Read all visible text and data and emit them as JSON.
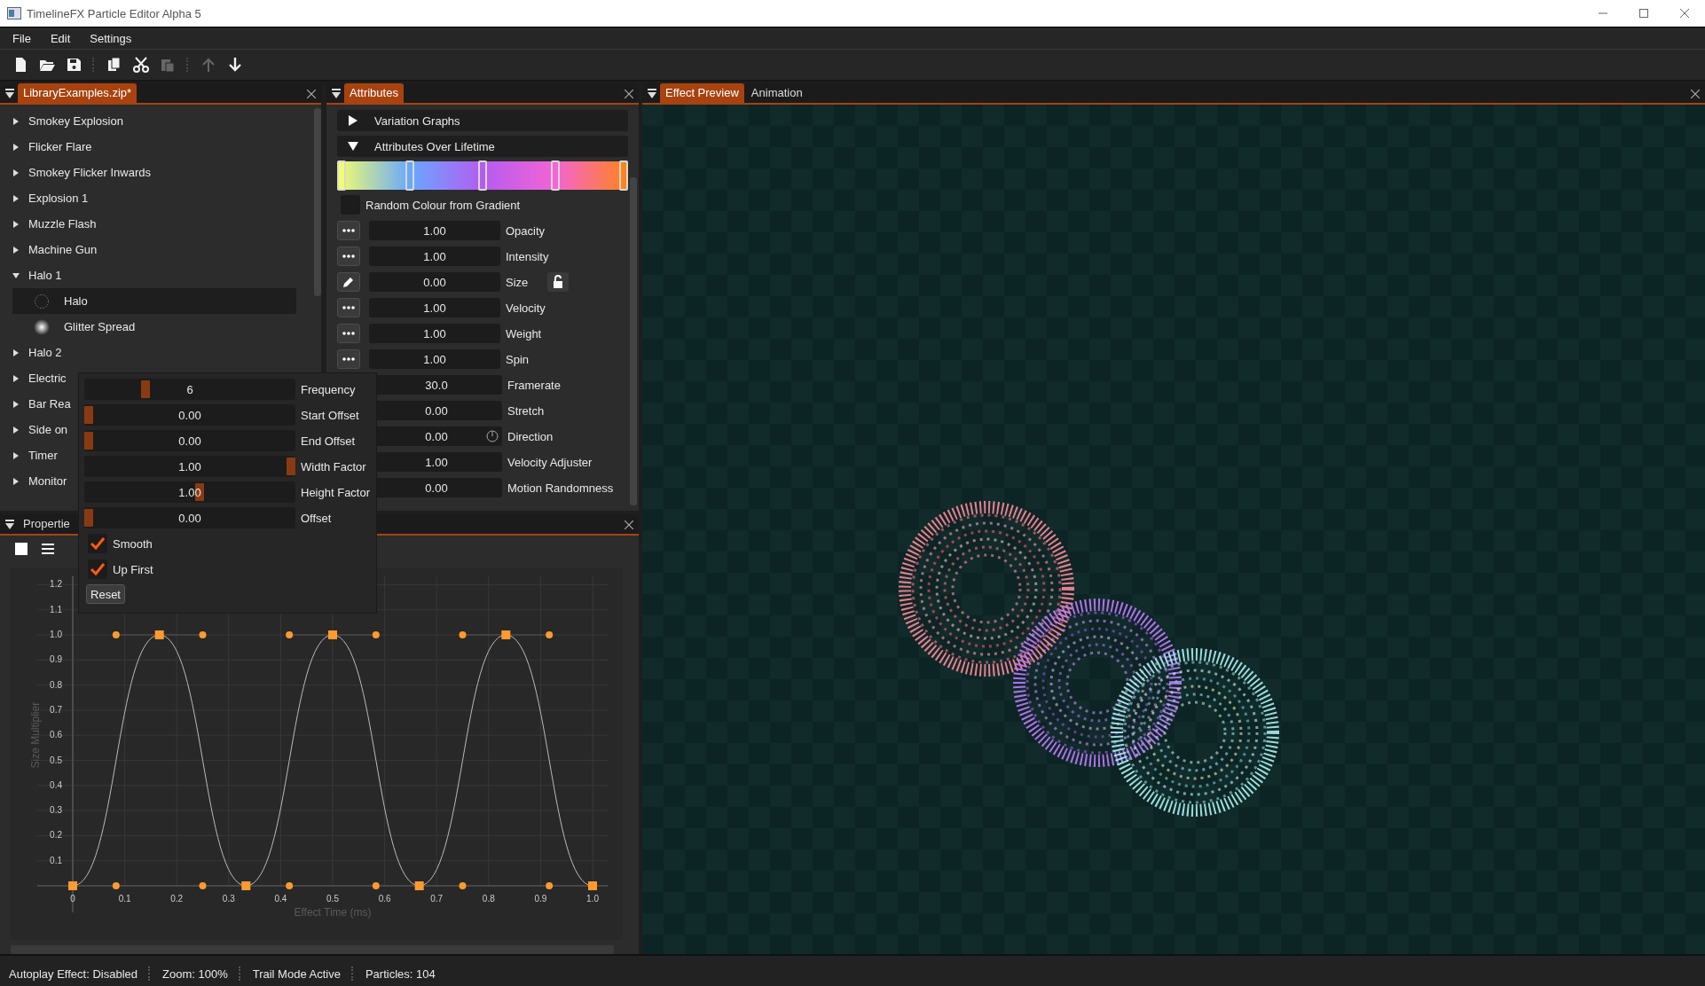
{
  "window": {
    "title": "TimelineFX Particle Editor Alpha 5"
  },
  "menu": [
    "File",
    "Edit",
    "Settings"
  ],
  "toolbar": [
    {
      "disabled": false
    },
    {
      "disabled": false
    },
    {
      "disabled": false
    },
    {
      "disabled": false
    },
    {
      "disabled": false
    },
    {
      "disabled": true
    },
    {
      "disabled": true
    },
    {
      "disabled": false
    }
  ],
  "library": {
    "tab": {
      "label": "LibraryExamples.zip*",
      "selected": true
    },
    "items": [
      {
        "label": "Smokey Explosion",
        "expanded": false,
        "selected": false
      },
      {
        "label": "Flicker Flare",
        "expanded": false,
        "selected": false
      },
      {
        "label": "Smokey Flicker Inwards",
        "expanded": false,
        "selected": false
      },
      {
        "label": "Explosion 1",
        "expanded": false,
        "selected": false
      },
      {
        "label": "Muzzle Flash",
        "expanded": false,
        "selected": false
      },
      {
        "label": "Machine Gun",
        "expanded": false,
        "selected": false
      },
      {
        "label": "Halo 1",
        "expanded": true,
        "selected": false,
        "children": [
          {
            "label": "Halo",
            "selected": true
          },
          {
            "label": "Glitter Spread",
            "selected": false
          }
        ]
      },
      {
        "label": "Halo 2",
        "expanded": false,
        "selected": false
      },
      {
        "label": "Electric",
        "expanded": false,
        "selected": false
      },
      {
        "label": "Bar Rea",
        "expanded": false,
        "selected": false
      },
      {
        "label": "Side on",
        "expanded": false,
        "selected": false
      },
      {
        "label": "Timer",
        "expanded": false,
        "selected": false
      },
      {
        "label": "Monitor",
        "expanded": false,
        "selected": false
      }
    ]
  },
  "attributes": {
    "tab": {
      "label": "Attributes",
      "selected": true
    },
    "sections": [
      {
        "label": "Variation Graphs",
        "expanded": false
      },
      {
        "label": "Attributes Over Lifetime",
        "expanded": true
      }
    ],
    "gradient": [
      {
        "color": "#f4ff6a"
      },
      {
        "color": "#68a8ff"
      },
      {
        "color": "#b45cf0"
      },
      {
        "color": "#f464d4"
      },
      {
        "color": "#ff8418"
      }
    ],
    "random_colour": {
      "label": "Random Colour from Gradient",
      "checked": false
    },
    "rows": [
      {
        "label": "Opacity",
        "value": "1.00",
        "kind": "graph"
      },
      {
        "label": "Intensity",
        "value": "1.00",
        "kind": "graph"
      },
      {
        "label": "Size",
        "value": "0.00",
        "kind": "edited",
        "locked": false
      },
      {
        "label": "Velocity",
        "value": "1.00",
        "kind": "graph"
      },
      {
        "label": "Weight",
        "value": "1.00",
        "kind": "graph"
      },
      {
        "label": "Spin",
        "value": "1.00",
        "kind": "graph"
      },
      {
        "label": "Framerate",
        "value": "30.0",
        "kind": "plain"
      },
      {
        "label": "Stretch",
        "value": "0.00",
        "kind": "plain"
      },
      {
        "label": "Direction",
        "value": "0.00",
        "kind": "angle"
      },
      {
        "label": "Velocity Adjuster",
        "value": "1.00",
        "kind": "plain"
      },
      {
        "label": "Motion Randomness",
        "value": "0.00",
        "kind": "plain"
      }
    ]
  },
  "popup": {
    "sliders": [
      {
        "label": "Frequency",
        "value": "6",
        "level": 0.28
      },
      {
        "label": "Start Offset",
        "value": "0.00",
        "level": 0
      },
      {
        "label": "End Offset",
        "value": "0.00",
        "level": 0
      },
      {
        "label": "Width Factor",
        "value": "1.00",
        "level": 1
      },
      {
        "label": "Height Factor",
        "value": "1.00",
        "level": 0.55
      },
      {
        "label": "Offset",
        "value": "0.00",
        "level": 0
      }
    ],
    "checkboxes": [
      {
        "label": "Smooth",
        "checked": true
      },
      {
        "label": "Up First",
        "checked": true
      }
    ],
    "button": "Reset"
  },
  "properties": {
    "tab": {
      "label": "Propertie",
      "selected": false
    },
    "chart_data": {
      "type": "line",
      "xlabel": "Effect Time (ms)",
      "ylabel": "Size Multiplier",
      "x": [
        0,
        0.1667,
        0.3333,
        0.5,
        0.6667,
        0.8333,
        1.0
      ],
      "series": [
        {
          "color": "#ff9a30",
          "marker": "square",
          "values": [
            0,
            1,
            0,
            1,
            0,
            1,
            0
          ]
        }
      ],
      "grid": true,
      "xlim": [
        0,
        1.03
      ],
      "ylim": [
        0,
        1.27
      ],
      "xticks": [
        0,
        0.1,
        0.2,
        0.3,
        0.4,
        0.5,
        0.6,
        0.7,
        0.8,
        0.9,
        {
          "value": 1,
          "label": "1.0"
        }
      ],
      "yticks": [
        0.1,
        0.2,
        0.3,
        0.4,
        0.5,
        0.6,
        0.7,
        0.8,
        0.9,
        {
          "value": 1,
          "label": "1.0"
        },
        1.1,
        1.2
      ]
    }
  },
  "preview": {
    "tabs": [
      {
        "label": "Effect Preview",
        "selected": true
      },
      {
        "label": "Animation",
        "selected": false
      }
    ]
  },
  "status_bar": [
    "Autoplay Effect: Disabled",
    "Zoom: 100%",
    "Trail Mode Active",
    "Particles: 104"
  ]
}
